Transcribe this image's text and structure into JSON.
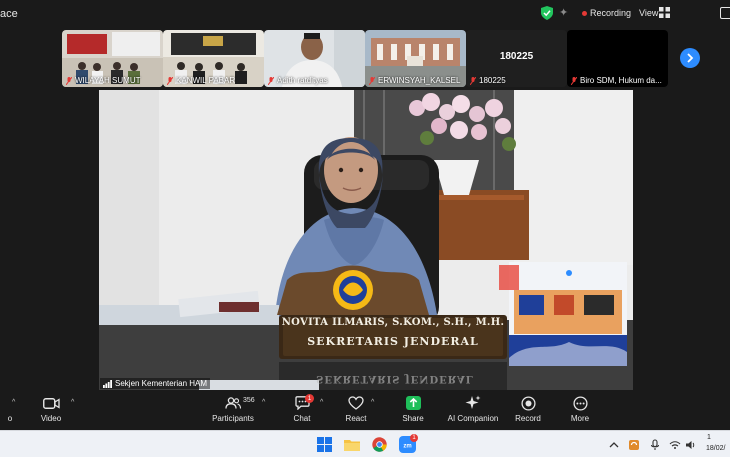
{
  "window": {
    "title": "ace"
  },
  "status": {
    "recording_label": "Recording",
    "view_label": "View"
  },
  "thumbnails": [
    {
      "name": "WILAYAH SUMUT"
    },
    {
      "name": "KANWIL PABAR"
    },
    {
      "name": "Adith ratdityas"
    },
    {
      "name": "ERWINSYAH_KALSEL"
    },
    {
      "name": "180225",
      "big_name": "180225"
    },
    {
      "name": "Biro SDM, Hukum da..."
    }
  ],
  "main_video": {
    "speaker_label": "Sekjen Kementerian HAM",
    "nameplate_line1": "NOVITA ILMARIS, S.KOM., S.H., M.H.",
    "nameplate_line2": "SEKRETARIS JENDERAL",
    "reflection_text": "SEKRETARIS JENDERAL"
  },
  "toolbar": {
    "items": [
      {
        "id": "audio",
        "label": "o"
      },
      {
        "id": "video",
        "label": "Video"
      },
      {
        "id": "participants",
        "label": "Participants",
        "count": "356"
      },
      {
        "id": "chat",
        "label": "Chat",
        "badge": "1"
      },
      {
        "id": "react",
        "label": "React"
      },
      {
        "id": "share",
        "label": "Share"
      },
      {
        "id": "ai",
        "label": "AI Companion"
      },
      {
        "id": "record",
        "label": "Record"
      },
      {
        "id": "more",
        "label": "More"
      }
    ]
  },
  "taskbar": {
    "zoom_badge": "1",
    "clock_time": "1",
    "clock_date": "18/02/"
  },
  "colors": {
    "accent": "#2d8cff",
    "record_red": "#e53935",
    "share_green": "#1fbf5a"
  }
}
